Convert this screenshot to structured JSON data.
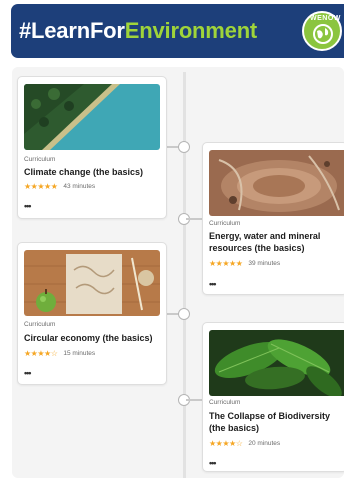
{
  "banner": {
    "title_part1": "#LearnFor",
    "title_part2": "Environment",
    "logo_text": "WENOW",
    "accent_color": "#9fd43a",
    "background_color": "#1d3f7a"
  },
  "courses": [
    {
      "category": "Curriculum",
      "title": "Climate change (the basics)",
      "rating_stars": "★★★★★",
      "duration": "43 minutes",
      "more_label": "•••",
      "rating": 5
    },
    {
      "category": "Curriculum",
      "title": "Energy, water and mineral resources (the basics)",
      "rating_stars": "★★★★★",
      "duration": "39 minutes",
      "more_label": "•••",
      "rating": 5
    },
    {
      "category": "Curriculum",
      "title": "Circular economy (the basics)",
      "rating_stars": "★★★★☆",
      "duration": "15 minutes",
      "more_label": "•••",
      "rating": 4.5
    },
    {
      "category": "Curriculum",
      "title": "The Collapse of Biodiversity (the basics)",
      "rating_stars": "★★★★☆",
      "duration": "20 minutes",
      "more_label": "•••",
      "rating": 4.5
    }
  ]
}
